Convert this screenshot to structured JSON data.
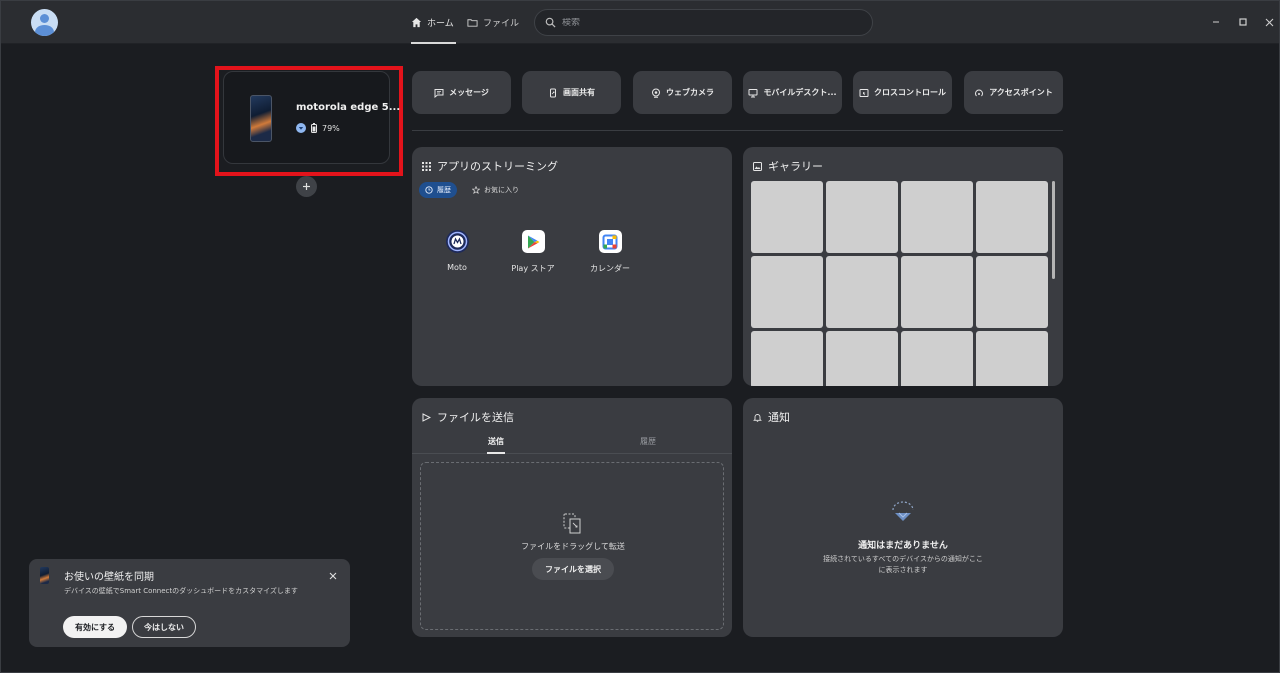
{
  "header": {
    "tabs": [
      {
        "label": "ホーム",
        "icon": "home-icon",
        "active": true
      },
      {
        "label": "ファイル",
        "icon": "folder-icon",
        "active": false
      }
    ],
    "search_placeholder": "検索"
  },
  "device": {
    "name": "motorola edge 5...",
    "battery": "79%"
  },
  "features": [
    {
      "label": "メッセージ",
      "icon": "message-icon"
    },
    {
      "label": "画面共有",
      "icon": "screen-share-icon"
    },
    {
      "label": "ウェブカメラ",
      "icon": "webcam-icon"
    },
    {
      "label": "モバイルデスクト...",
      "icon": "monitor-icon"
    },
    {
      "label": "クロスコントロール",
      "icon": "cross-control-icon"
    },
    {
      "label": "アクセスポイント",
      "icon": "hotspot-icon"
    }
  ],
  "streaming": {
    "title": "アプリのストリーミング",
    "chips": {
      "history": "履歴",
      "favorites": "お気に入り"
    },
    "apps": [
      {
        "label": "Moto"
      },
      {
        "label": "Play ストア"
      },
      {
        "label": "カレンダー"
      }
    ]
  },
  "gallery": {
    "title": "ギャラリー"
  },
  "send_file": {
    "title": "ファイルを送信",
    "tabs": {
      "send": "送信",
      "history": "履歴"
    },
    "drop_hint": "ファイルをドラッグして転送",
    "select_button": "ファイルを選択"
  },
  "notifications": {
    "title": "通知",
    "empty_title": "通知はまだありません",
    "empty_body": "接続されているすべてのデバイスからの通知がここに表示されます"
  },
  "toast": {
    "title": "お使いの壁紙を同期",
    "body": "デバイスの壁紙でSmart Connectのダッシュボードをカスタマイズします",
    "enable_button": "有効にする",
    "later_button": "今はしない"
  },
  "colors": {
    "highlight": "#e3131b",
    "accent": "#1f4f8f",
    "panel": "#3a3c41",
    "background": "#1b1d21"
  }
}
